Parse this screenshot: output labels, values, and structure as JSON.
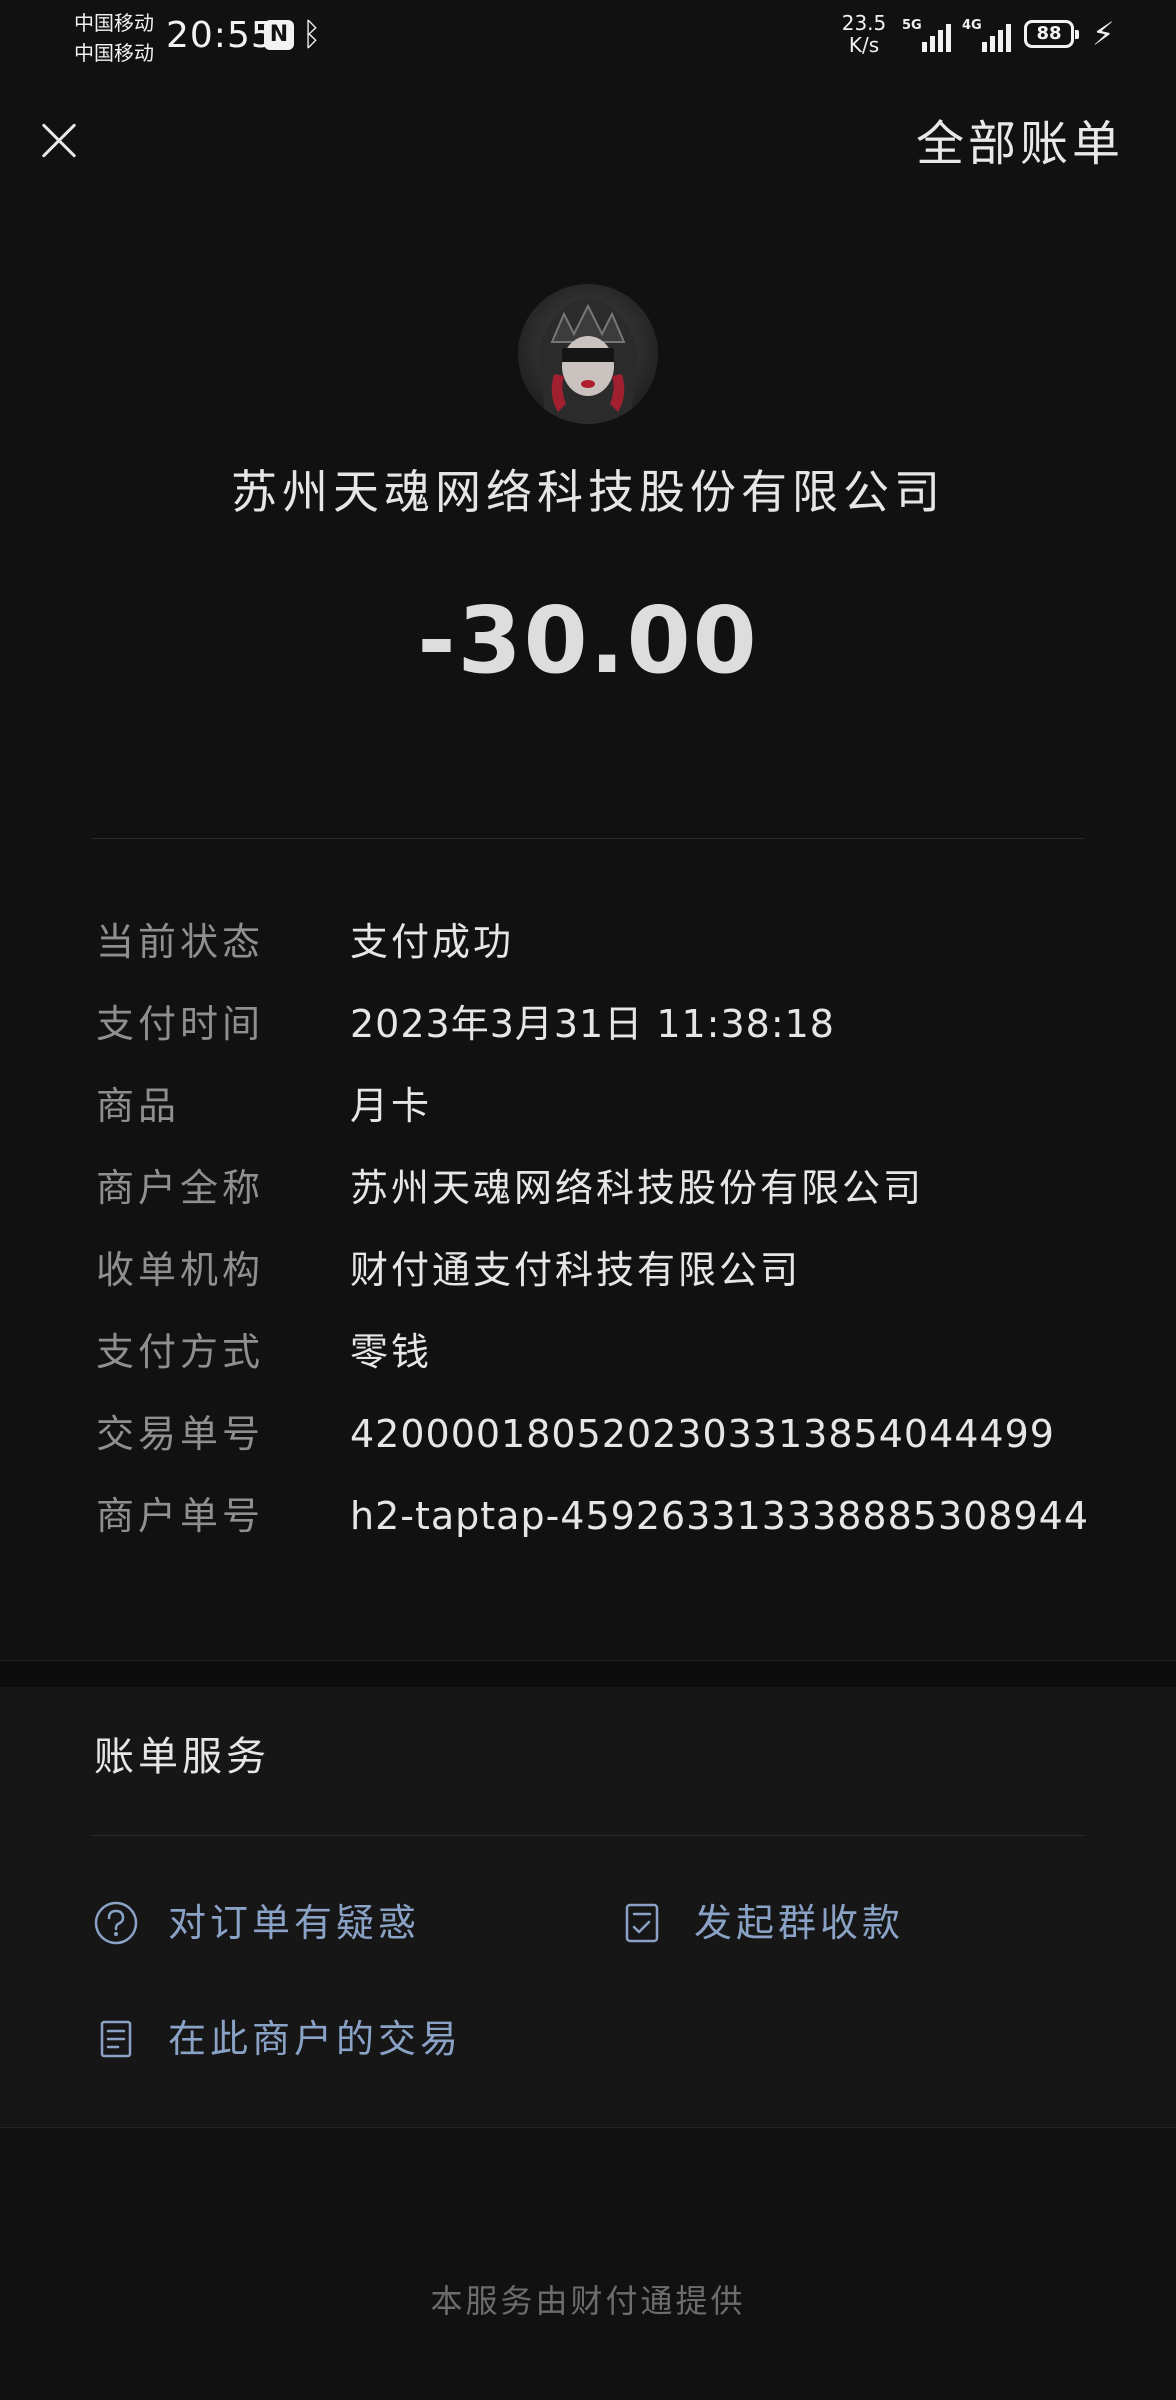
{
  "status_bar": {
    "carrier_1": "中国移动",
    "carrier_2": "中国移动",
    "time": "20:55",
    "net_speed_value": "23.5",
    "net_speed_unit": "K/s",
    "signal_1_label": "5G",
    "signal_2_label": "4G",
    "battery_level": "88"
  },
  "nav": {
    "close_icon": "close-icon",
    "all_bills_label": "全部账单"
  },
  "merchant": {
    "name": "苏州天魂网络科技股份有限公司",
    "amount": "-30.00"
  },
  "details": [
    {
      "label": "当前状态",
      "value": "支付成功"
    },
    {
      "label": "支付时间",
      "value": "2023年3月31日 11:38:18"
    },
    {
      "label": "商品",
      "value": "月卡"
    },
    {
      "label": "商户全称",
      "value": "苏州天魂网络科技股份有限公司"
    },
    {
      "label": "收单机构",
      "value": "财付通支付科技有限公司"
    },
    {
      "label": "支付方式",
      "value": "零钱"
    },
    {
      "label": "交易单号",
      "value": "4200001805202303313854044499"
    },
    {
      "label": "商户单号",
      "value": "h2-taptap-459263313338885308944"
    }
  ],
  "services": {
    "title": "账单服务",
    "items": [
      {
        "label": "对订单有疑惑",
        "icon": "question-circle-icon"
      },
      {
        "label": "发起群收款",
        "icon": "checklist-icon"
      },
      {
        "label": "在此商户的交易",
        "icon": "document-icon"
      }
    ]
  },
  "footer": "本服务由财付通提供",
  "colors": {
    "background": "#111111",
    "service_link": "#8aa2c6",
    "label_gray": "#8f8f8f"
  }
}
